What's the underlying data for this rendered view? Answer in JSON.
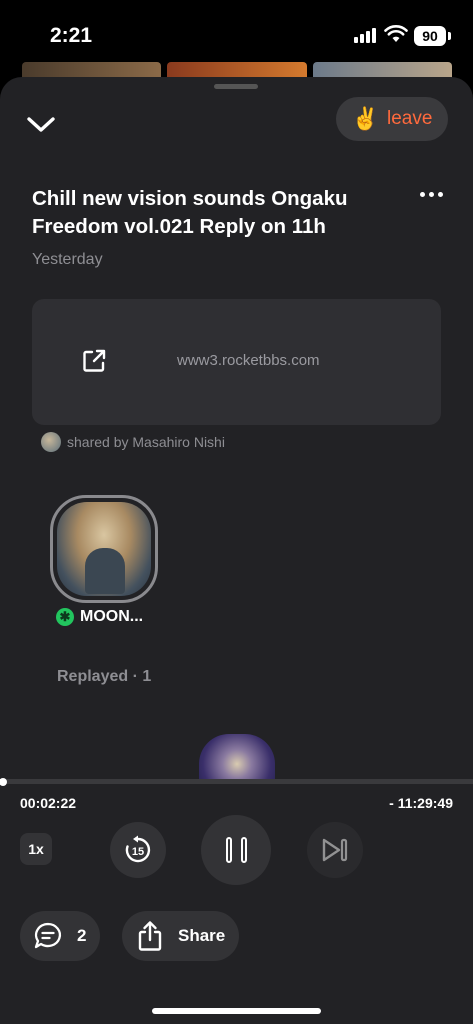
{
  "status_bar": {
    "time": "2:21",
    "battery": "90"
  },
  "header": {
    "leave_emoji": "✌️",
    "leave_label": "leave"
  },
  "room": {
    "title": "Chill new vision sounds Ongaku Freedom vol.021 Reply on 11h",
    "date": "Yesterday"
  },
  "link_card": {
    "url": "www3.rocketbbs.com",
    "shared_by": "shared by Masahiro Nishi"
  },
  "speaker": {
    "name": "MOON...",
    "badge_glyph": "✱"
  },
  "replayed": "Replayed · 1",
  "player": {
    "elapsed": "00:02:22",
    "remaining": "- 11:29:49",
    "progress_fraction": 0.003,
    "speed": "1x",
    "rewind_seconds": "15"
  },
  "actions": {
    "comment_count": "2",
    "share_label": "Share"
  },
  "colors": {
    "accent": "#ff6a3d",
    "online": "#22c55e",
    "sheet_bg": "#222225"
  }
}
